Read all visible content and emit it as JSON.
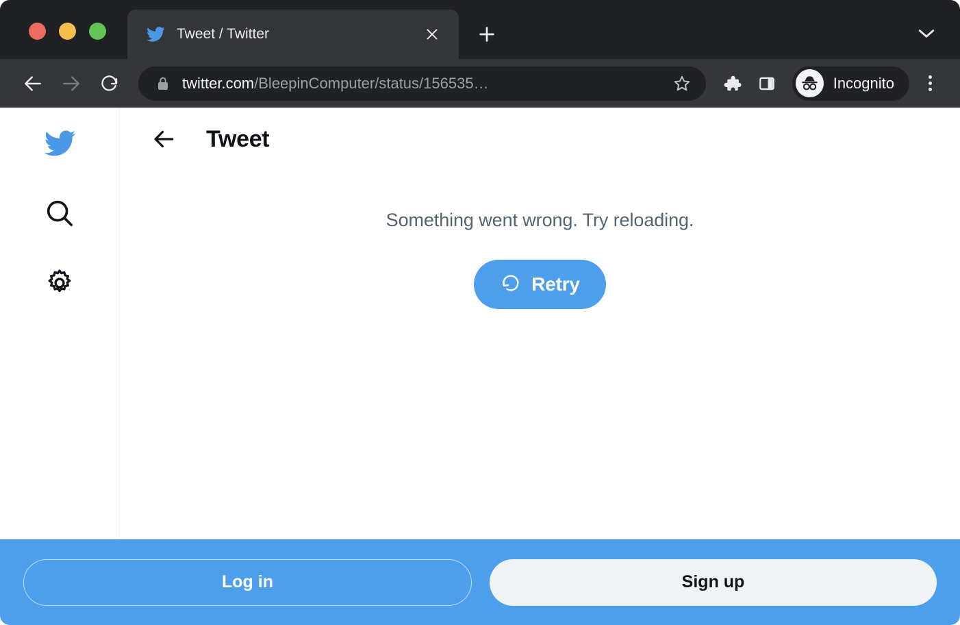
{
  "window": {
    "traffic_lights": [
      {
        "name": "close",
        "color": "#ED6A5E"
      },
      {
        "name": "minimize",
        "color": "#F5BE4F"
      },
      {
        "name": "maximize",
        "color": "#61C554"
      }
    ]
  },
  "browser": {
    "tab": {
      "title": "Tweet / Twitter",
      "favicon": "twitter-bird-icon",
      "close_icon": "close-icon"
    },
    "new_tab_icon": "plus-icon",
    "tab_list_icon": "chevron-down-icon",
    "nav": {
      "back_icon": "arrow-left-icon",
      "forward_icon": "arrow-right-icon",
      "reload_icon": "reload-icon"
    },
    "omnibox": {
      "lock_icon": "lock-icon",
      "url_host": "twitter.com",
      "url_path": "/BleepinComputer/status/156535…",
      "url_full": "twitter.com/BleepinComputer/status/156535…",
      "star_icon": "star-icon"
    },
    "extensions_icon": "puzzle-piece-icon",
    "side_panel_icon": "side-panel-icon",
    "profile": {
      "label": "Incognito",
      "icon": "incognito-icon"
    },
    "menu_icon": "three-dot-menu-icon"
  },
  "twitter": {
    "sidebar": [
      {
        "name": "home",
        "icon": "twitter-bird-icon"
      },
      {
        "name": "explore",
        "icon": "search-icon"
      },
      {
        "name": "settings",
        "icon": "gear-icon"
      }
    ],
    "header": {
      "back_icon": "arrow-left-icon",
      "title": "Tweet"
    },
    "error": {
      "message": "Something went wrong. Try reloading.",
      "retry_label": "Retry",
      "retry_icon": "refresh-circle-icon"
    },
    "login_bar": {
      "login_label": "Log in",
      "signup_label": "Sign up"
    }
  },
  "colors": {
    "titlebar_bg": "#202124",
    "toolbar_bg": "#35363A",
    "omnibox_bg": "#202124",
    "twitter_blue": "#4D9FEB",
    "twitter_logo_blue": "#4A99E9",
    "error_text": "#536471",
    "heading": "#0F1419",
    "signup_bg": "#EFF3F4"
  }
}
